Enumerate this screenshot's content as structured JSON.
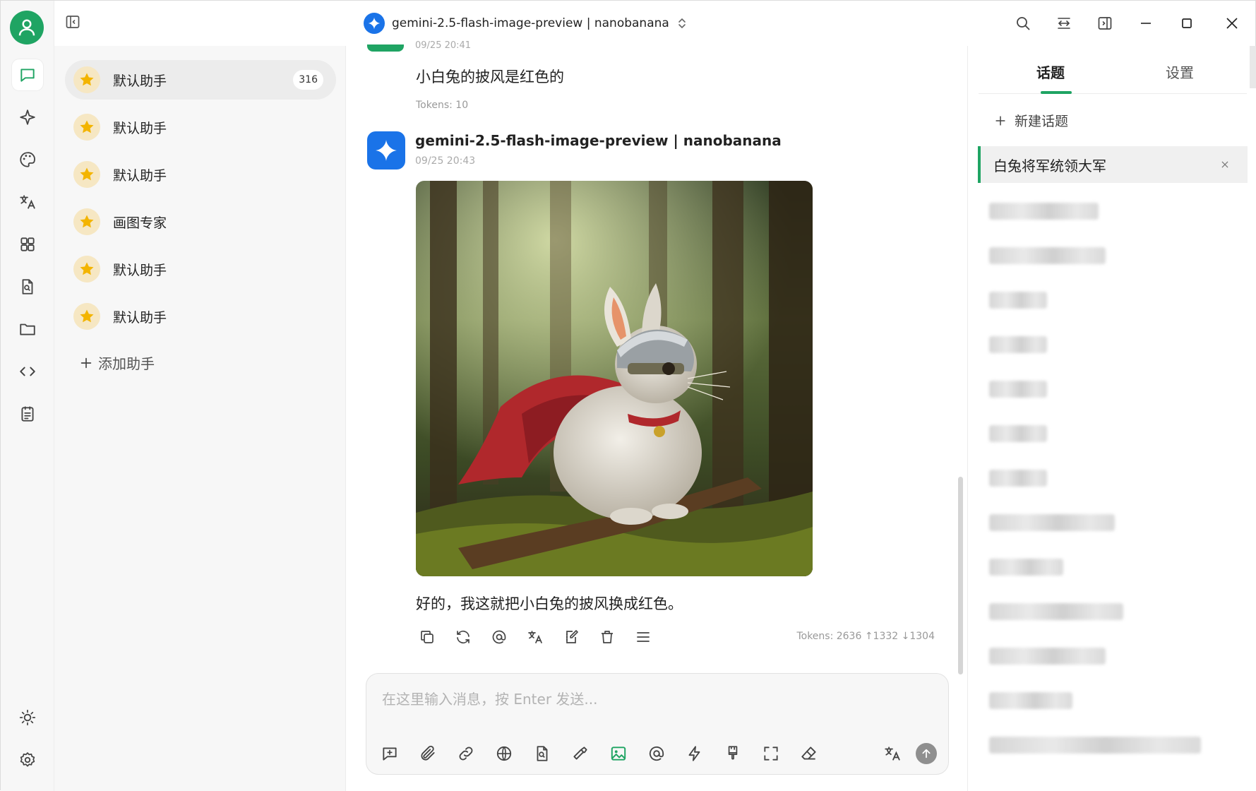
{
  "window": {
    "model_title": "gemini-2.5-flash-image-preview | nanobanana"
  },
  "rail": {
    "items": [
      "chat-icon",
      "sparkle-icon",
      "palette-icon",
      "translate-icon",
      "apps-icon",
      "file-search-icon",
      "folder-icon",
      "code-icon",
      "notes-icon"
    ],
    "bottom": [
      "theme-sun-icon",
      "settings-gear-icon"
    ]
  },
  "assistants": {
    "items": [
      {
        "name": "默认助手",
        "count": "316",
        "active": true
      },
      {
        "name": "默认助手"
      },
      {
        "name": "默认助手"
      },
      {
        "name": "画图专家"
      },
      {
        "name": "默认助手"
      },
      {
        "name": "默认助手"
      }
    ],
    "add_label": "添加助手"
  },
  "chat": {
    "prev_time": "09/25 20:41",
    "user_message": "小白兔的披风是红色的",
    "user_tokens": "Tokens: 10",
    "bot_name": "gemini-2.5-flash-image-preview | nanobanana",
    "bot_time": "09/25 20:43",
    "image_description": "rabbit-in-helmet-red-cape-forest",
    "bot_message": "好的，我这就把小白兔的披风换成红色。",
    "bot_tokens": "Tokens: 2636 ↑1332 ↓1304",
    "composer_placeholder": "在这里输入消息，按 Enter 发送..."
  },
  "topics": {
    "tabs": [
      "话题",
      "设置"
    ],
    "new_topic": "新建话题",
    "active_topic": "白兔将军统领大军",
    "blurred_count": 13
  },
  "colors": {
    "accent": "#1fa463",
    "gemini_blue": "#1a73e8"
  }
}
